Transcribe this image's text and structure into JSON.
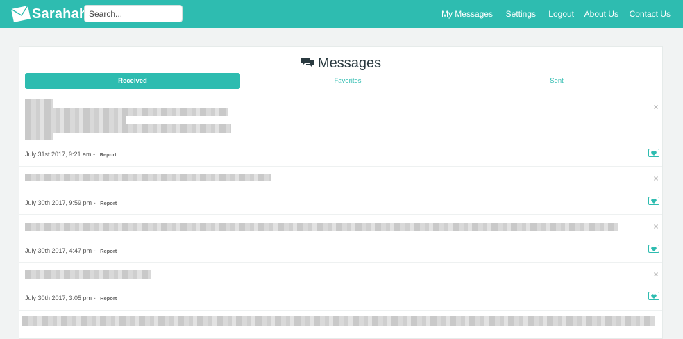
{
  "navbar": {
    "brand": "Sarahah",
    "search_placeholder": "Search...",
    "links": [
      "My Messages",
      "Settings",
      "Logout",
      "About Us",
      "Contact Us"
    ]
  },
  "page": {
    "title": "Messages",
    "tabs": [
      "Received",
      "Favorites",
      "Sent"
    ],
    "active_tab": "Received"
  },
  "messages": [
    {
      "date": "July 31st 2017, 9:21 am",
      "report": "Report"
    },
    {
      "date": "July 30th 2017, 9:59 pm",
      "report": "Report"
    },
    {
      "date": "July 30th 2017, 4:47 pm",
      "report": "Report"
    },
    {
      "date": "July 30th 2017, 3:05 pm",
      "report": "Report"
    }
  ],
  "colors": {
    "accent": "#2ebcb0",
    "title": "#2a3a40",
    "background": "#f1f3f3"
  },
  "icons": {
    "brand": "envelope-icon",
    "title": "comments-icon",
    "close": "close-icon",
    "favorite": "heart-icon"
  }
}
